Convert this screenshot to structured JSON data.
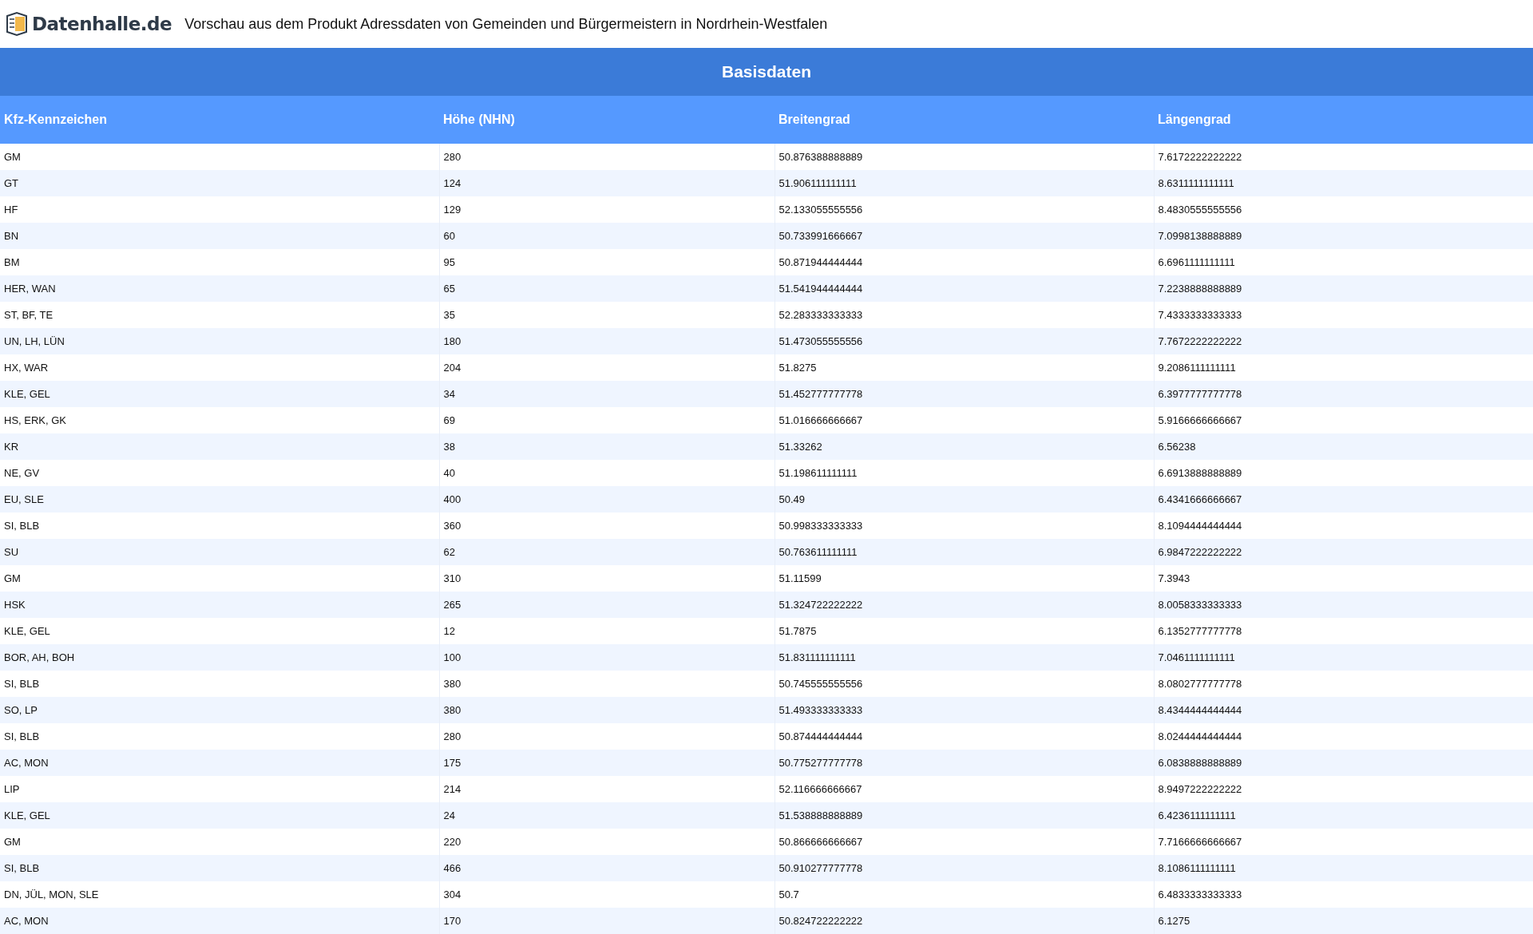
{
  "header": {
    "logo_text": "Datenhalle.de",
    "title": "Vorschau aus dem Produkt Adressdaten von Gemeinden und Bürgermeistern in Nordrhein-Westfalen"
  },
  "table": {
    "caption": "Basisdaten",
    "columns": [
      "Kfz-Kennzeichen",
      "Höhe (NHN)",
      "Breitengrad",
      "Längengrad"
    ],
    "rows": [
      [
        "GM",
        "280",
        "50.876388888889",
        "7.6172222222222"
      ],
      [
        "GT",
        "124",
        "51.906111111111",
        "8.6311111111111"
      ],
      [
        "HF",
        "129",
        "52.133055555556",
        "8.4830555555556"
      ],
      [
        "BN",
        "60",
        "50.733991666667",
        "7.0998138888889"
      ],
      [
        "BM",
        "95",
        "50.871944444444",
        "6.6961111111111"
      ],
      [
        "HER, WAN",
        "65",
        "51.541944444444",
        "7.2238888888889"
      ],
      [
        "ST, BF, TE",
        "35",
        "52.283333333333",
        "7.4333333333333"
      ],
      [
        "UN, LH, LÜN",
        "180",
        "51.473055555556",
        "7.7672222222222"
      ],
      [
        "HX, WAR",
        "204",
        "51.8275",
        "9.2086111111111"
      ],
      [
        "KLE, GEL",
        "34",
        "51.452777777778",
        "6.3977777777778"
      ],
      [
        "HS, ERK, GK",
        "69",
        "51.016666666667",
        "5.9166666666667"
      ],
      [
        "KR",
        "38",
        "51.33262",
        "6.56238"
      ],
      [
        "NE, GV",
        "40",
        "51.198611111111",
        "6.6913888888889"
      ],
      [
        "EU, SLE",
        "400",
        "50.49",
        "6.4341666666667"
      ],
      [
        "SI, BLB",
        "360",
        "50.998333333333",
        "8.1094444444444"
      ],
      [
        "SU",
        "62",
        "50.763611111111",
        "6.9847222222222"
      ],
      [
        "GM",
        "310",
        "51.11599",
        "7.3943"
      ],
      [
        "HSK",
        "265",
        "51.324722222222",
        "8.0058333333333"
      ],
      [
        "KLE, GEL",
        "12",
        "51.7875",
        "6.1352777777778"
      ],
      [
        "BOR, AH, BOH",
        "100",
        "51.831111111111",
        "7.0461111111111"
      ],
      [
        "SI, BLB",
        "380",
        "50.745555555556",
        "8.0802777777778"
      ],
      [
        "SO, LP",
        "380",
        "51.493333333333",
        "8.4344444444444"
      ],
      [
        "SI, BLB",
        "280",
        "50.874444444444",
        "8.0244444444444"
      ],
      [
        "AC, MON",
        "175",
        "50.775277777778",
        "6.0838888888889"
      ],
      [
        "LIP",
        "214",
        "52.116666666667",
        "8.9497222222222"
      ],
      [
        "KLE, GEL",
        "24",
        "51.538888888889",
        "6.4236111111111"
      ],
      [
        "GM",
        "220",
        "50.866666666667",
        "7.7166666666667"
      ],
      [
        "SI, BLB",
        "466",
        "50.910277777778",
        "8.1086111111111"
      ],
      [
        "DN, JÜL, MON, SLE",
        "304",
        "50.7",
        "6.4833333333333"
      ],
      [
        "AC, MON",
        "170",
        "50.824722222222",
        "6.1275"
      ]
    ]
  }
}
